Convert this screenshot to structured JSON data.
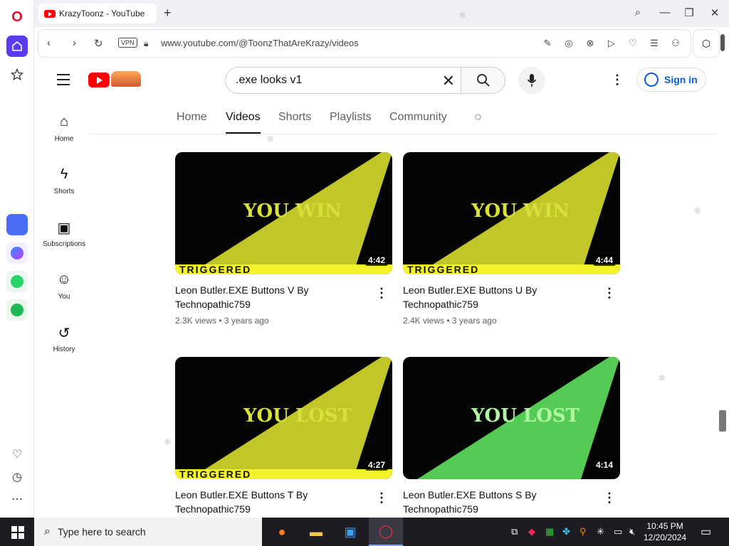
{
  "browser": {
    "tab_title": "KrazyToonz - YouTube",
    "url": "www.youtube.com/@ToonzThatAreKrazy/videos",
    "vpn_label": "VPN",
    "new_tab_symbol": "+"
  },
  "youtube": {
    "search_value": ".exe looks v1",
    "sign_in_label": "Sign in",
    "guide": [
      {
        "label": "Home",
        "icon": "home-icon"
      },
      {
        "label": "Shorts",
        "icon": "shorts-icon"
      },
      {
        "label": "Subscriptions",
        "icon": "subscriptions-icon"
      },
      {
        "label": "You",
        "icon": "you-icon"
      },
      {
        "label": "History",
        "icon": "history-icon"
      }
    ],
    "channel_tabs": [
      "Home",
      "Videos",
      "Shorts",
      "Playlists",
      "Community"
    ],
    "active_tab": "Videos",
    "videos": [
      {
        "title": "Leon Butler.EXE Buttons V By Technopathic759",
        "views": "2.3K views",
        "age": "3 years ago",
        "duration": "4:42",
        "thumb_text": "YOU WIN",
        "banner": "TRIGGERED",
        "tint": "#d6dc2e"
      },
      {
        "title": "Leon Butler.EXE Buttons U By Technopathic759",
        "views": "2.4K views",
        "age": "3 years ago",
        "duration": "4:44",
        "thumb_text": "YOU WIN",
        "banner": "TRIGGERED",
        "tint": "#d6dc2e"
      },
      {
        "title": "Leon Butler.EXE Buttons T By Technopathic759",
        "views": "",
        "age": "",
        "duration": "4:27",
        "thumb_text": "YOU LOST",
        "banner": "TRIGGERED",
        "tint": "#d6dc2e"
      },
      {
        "title": "Leon Butler.EXE Buttons S By Technopathic759",
        "views": "",
        "age": "",
        "duration": "4:14",
        "thumb_text": "YOU LOST",
        "banner": "",
        "tint": "#5ee05e"
      }
    ]
  },
  "taskbar": {
    "search_placeholder": "Type here to search",
    "time": "10:45 PM",
    "date": "12/20/2024"
  }
}
